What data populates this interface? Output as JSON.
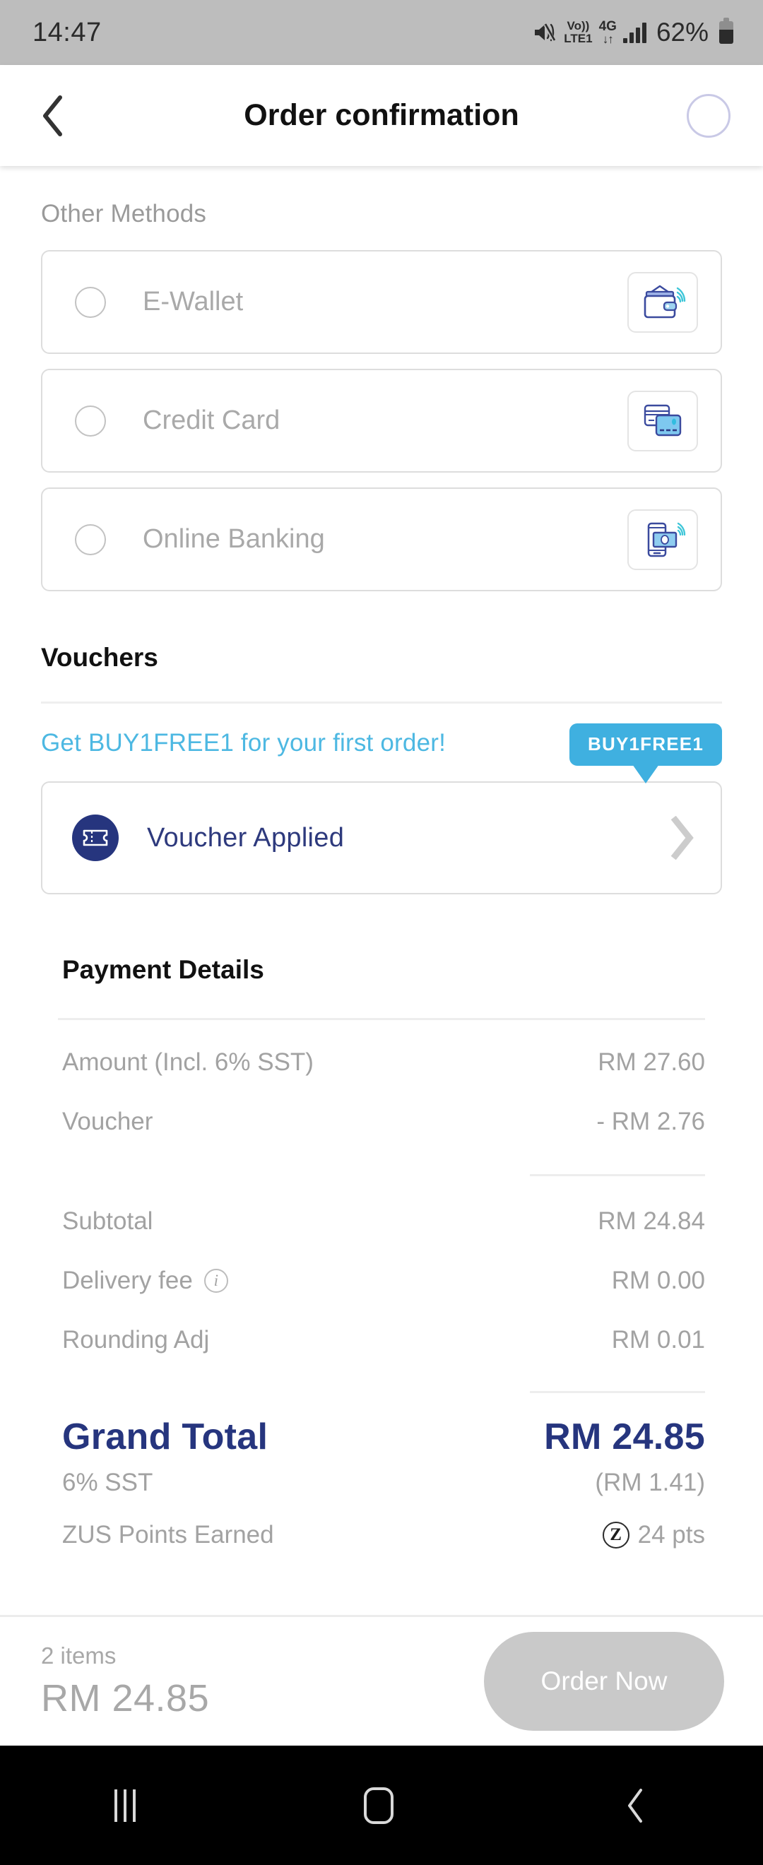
{
  "status_bar": {
    "time": "14:47",
    "mute_icon": "mute-icon",
    "volte_top": "Vo))",
    "volte_bottom": "LTE1",
    "network": "4G",
    "network_arrows": "↓↑",
    "signal_icon": "signal-bars-icon",
    "battery_percent": "62%",
    "battery_icon": "battery-icon"
  },
  "header": {
    "back_icon": "back-chevron-icon",
    "title": "Order confirmation",
    "right_circle_icon": "loading-circle-icon"
  },
  "payment_methods": {
    "section_label": "Other Methods",
    "items": [
      {
        "label": "E-Wallet",
        "icon": "wallet-nfc-icon",
        "selected": false
      },
      {
        "label": "Credit Card",
        "icon": "credit-card-icon",
        "selected": false
      },
      {
        "label": "Online Banking",
        "icon": "mobile-banking-nfc-icon",
        "selected": false
      }
    ]
  },
  "vouchers": {
    "section_label": "Vouchers",
    "promo_text": "Get BUY1FREE1 for your first order!",
    "promo_badge": "BUY1FREE1",
    "applied_icon": "ticket-icon",
    "applied_label": "Voucher Applied",
    "chevron_icon": "chevron-right-icon"
  },
  "payment_details": {
    "title": "Payment Details",
    "rows": [
      {
        "label": "Amount (Incl. 6% SST)",
        "value": "RM 27.60"
      },
      {
        "label": "Voucher",
        "value": "- RM 2.76"
      }
    ],
    "rows2": [
      {
        "label": "Subtotal",
        "value": "RM 24.84"
      },
      {
        "label": "Delivery fee",
        "value": "RM 0.00",
        "info_icon": "info-icon"
      },
      {
        "label": "Rounding Adj",
        "value": "RM 0.01"
      }
    ],
    "grand_total_label": "Grand Total",
    "grand_total_value": "RM 24.85",
    "sst_label": "6% SST",
    "sst_value": "(RM 1.41)",
    "points_label": "ZUS Points Earned",
    "points_mark": "Z",
    "points_value": "24 pts"
  },
  "bottom_bar": {
    "items_count": "2 items",
    "total": "RM 24.85",
    "order_button": "Order Now"
  },
  "nav_bar": {
    "recent_icon": "recent-apps-icon",
    "home_icon": "home-icon",
    "back_icon": "nav-back-icon"
  },
  "colors": {
    "brand_navy": "#26357e",
    "accent_blue": "#3fb0e0",
    "muted_grey": "#a2a2a2",
    "disabled_button": "#c9c9c9"
  }
}
